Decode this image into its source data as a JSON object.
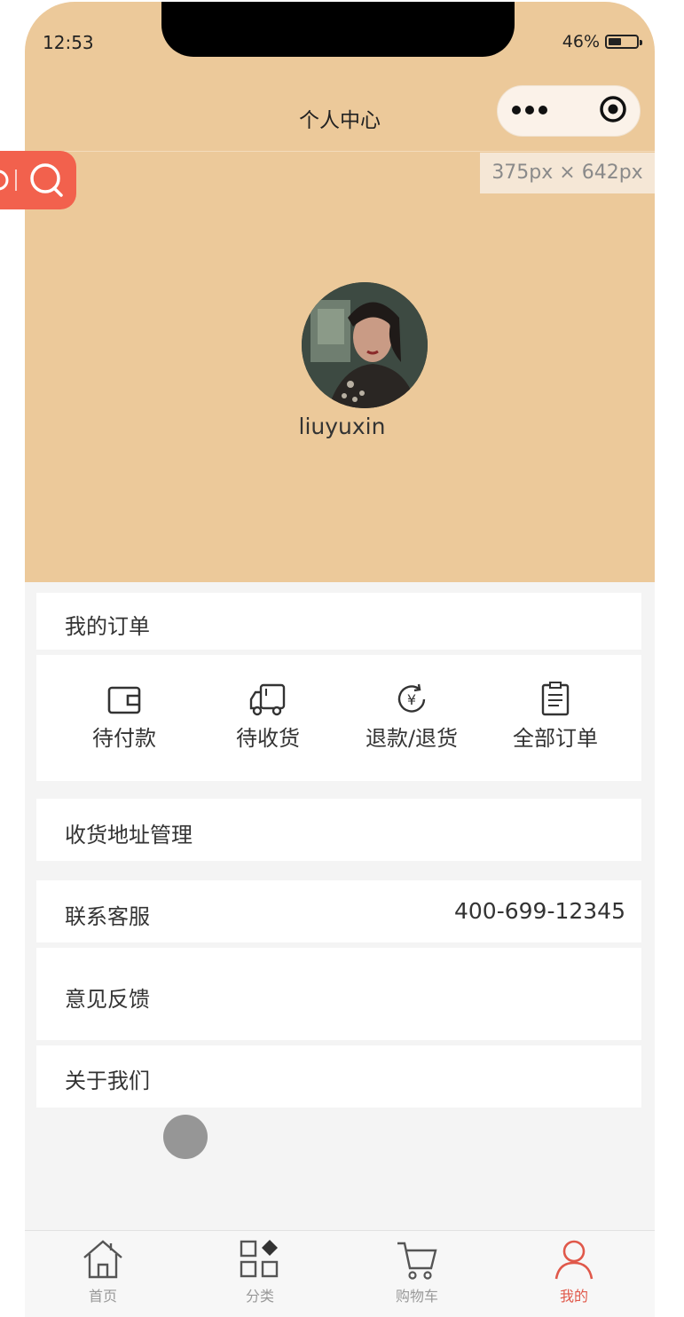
{
  "status_bar": {
    "time": "12:53",
    "battery": "46%",
    "battery_level": 0.46
  },
  "nav": {
    "title": "个人中心"
  },
  "dimension_label": "375px × 642px",
  "profile": {
    "username": "liuyuxin"
  },
  "orders": {
    "title": "我的订单",
    "items": [
      {
        "label": "待付款",
        "icon": "wallet-icon"
      },
      {
        "label": "待收货",
        "icon": "truck-icon"
      },
      {
        "label": "退款/退货",
        "icon": "refund-icon"
      },
      {
        "label": "全部订单",
        "icon": "order-list-icon"
      }
    ]
  },
  "menu": {
    "address": "收货地址管理",
    "contact_label": "联系客服",
    "contact_phone": "400-699-12345",
    "feedback": "意见反馈",
    "about": "关于我们"
  },
  "tabbar": {
    "items": [
      {
        "label": "首页",
        "icon": "home-icon"
      },
      {
        "label": "分类",
        "icon": "category-icon"
      },
      {
        "label": "购物车",
        "icon": "cart-icon"
      },
      {
        "label": "我的",
        "icon": "user-icon",
        "active": true
      }
    ],
    "active_color": "#e0584a"
  },
  "colors": {
    "header": "#ecc99a",
    "background": "#f4f4f4",
    "accent": "#f2614d"
  }
}
